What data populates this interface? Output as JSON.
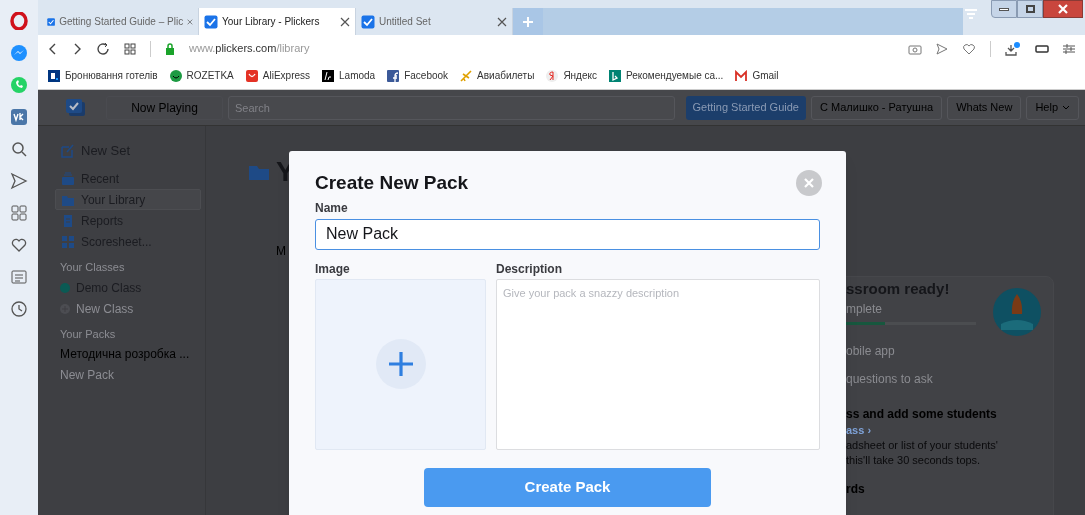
{
  "browser": {
    "tabs": [
      {
        "title": "Getting Started Guide – Plic",
        "selected": false
      },
      {
        "title": "Your Library - Plickers",
        "selected": true
      },
      {
        "title": "Untitled Set",
        "selected": false
      }
    ],
    "address": {
      "domain": "www.",
      "host": "plickers.com",
      "path": "/library"
    },
    "bookmarks": [
      {
        "kind": "booking",
        "label": "Бронювання готелів"
      },
      {
        "kind": "rozetka",
        "label": "ROZETKA"
      },
      {
        "kind": "aliexpress",
        "label": "AliExpress"
      },
      {
        "kind": "lamoda",
        "label": "Lamoda"
      },
      {
        "kind": "facebook",
        "label": "Facebook"
      },
      {
        "kind": "plane",
        "label": "Авиабилеты"
      },
      {
        "kind": "yandex",
        "label": "Яндекс"
      },
      {
        "kind": "bing",
        "label": "Рекомендуемые са..."
      },
      {
        "kind": "gmail",
        "label": "Gmail"
      }
    ]
  },
  "app": {
    "nav": {
      "now_playing": "Now Playing",
      "search_placeholder": "Search",
      "guide": "Getting Started Guide",
      "user": "С Малишко - Ратушна",
      "whats_new": "Whats New",
      "help": "Help"
    },
    "sidebar": {
      "items": [
        {
          "kind": "new",
          "label": "New Set",
          "selected": false
        },
        {
          "kind": "recent",
          "label": "Recent",
          "selected": false
        },
        {
          "kind": "library",
          "label": "Your Library",
          "selected": true
        },
        {
          "kind": "reports",
          "label": "Reports",
          "selected": false
        },
        {
          "kind": "scoresheet",
          "label": "Scoresheet...",
          "selected": false
        }
      ],
      "classes_heading": "Your Classes",
      "classes": [
        {
          "kind": "class",
          "label": "Demo Class",
          "color": "#0b5a54"
        },
        {
          "kind": "add",
          "label": "New Class"
        }
      ],
      "packs_heading": "Your Packs",
      "packs": [
        {
          "kind": "pack",
          "label": "Методична розробка ..."
        },
        {
          "kind": "add",
          "label": "New Pack"
        }
      ]
    },
    "main": {
      "title": "Y",
      "row_text": "M"
    },
    "card": {
      "title": "ssroom ready!",
      "subtitle": "mplete",
      "level": 0.3,
      "lines": [
        {
          "kind": "step",
          "text": "obile app"
        },
        {
          "kind": "step",
          "text": "questions to ask"
        },
        {
          "kind": "heading",
          "text": "ss and add some students"
        },
        {
          "kind": "link",
          "text": "ass ›"
        },
        {
          "kind": "body",
          "text": "adsheet or list of your students'"
        },
        {
          "kind": "body",
          "text": "this'll take 30 seconds tops."
        },
        {
          "kind": "heading",
          "text": "rds"
        }
      ]
    }
  },
  "modal": {
    "title": "Create New Pack",
    "name_label": "Name",
    "name_value": "New Pack",
    "image_label": "Image",
    "description_label": "Description",
    "description_placeholder": "Give your pack a snazzy description",
    "submit": "Create Pack"
  }
}
